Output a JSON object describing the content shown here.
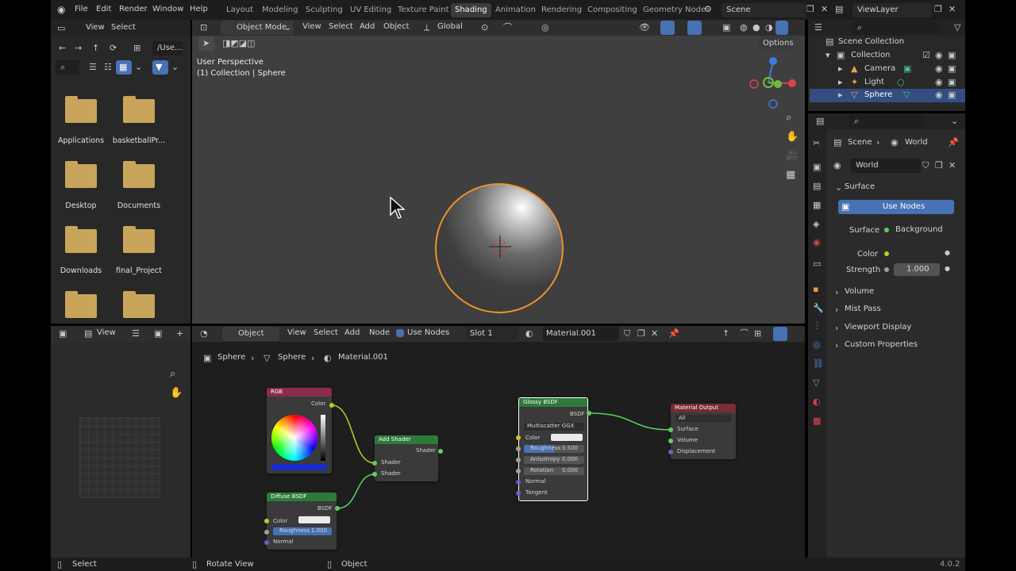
{
  "menu": {
    "file": "File",
    "edit": "Edit",
    "render": "Render",
    "window": "Window",
    "help": "Help"
  },
  "workspaces": [
    "Layout",
    "Modeling",
    "Sculpting",
    "UV Editing",
    "Texture Paint",
    "Shading",
    "Animation",
    "Rendering",
    "Compositing",
    "Geometry Node"
  ],
  "active_workspace": "Shading",
  "scene_field": "Scene",
  "viewlayer_field": "ViewLayer",
  "filebrowser": {
    "view": "View",
    "select": "Select",
    "path": "/Use...",
    "items": [
      "Applications",
      "basketballPr...",
      "Desktop",
      "Documents",
      "Downloads",
      "final_Project"
    ]
  },
  "viewport": {
    "mode": "Object Mode",
    "view": "View",
    "select": "Select",
    "add": "Add",
    "object": "Object",
    "orientation": "Global",
    "options": "Options",
    "overlay_line1": "User Perspective",
    "overlay_line2": "(1) Collection | Sphere"
  },
  "outliner": {
    "scene_collection": "Scene Collection",
    "collection": "Collection",
    "items": [
      "Camera",
      "Light",
      "Sphere"
    ]
  },
  "properties": {
    "breadcrumb_scene": "Scene",
    "breadcrumb_world": "World",
    "world_name": "World",
    "surface_header": "Surface",
    "use_nodes_btn": "Use Nodes",
    "surface_label": "Surface",
    "surface_value": "Background",
    "color_label": "Color",
    "strength_label": "Strength",
    "strength_value": "1.000",
    "sections": [
      "Volume",
      "Mist Pass",
      "Viewport Display",
      "Custom Properties"
    ]
  },
  "image_editor": {
    "view": "View"
  },
  "node_editor": {
    "object": "Object",
    "view": "View",
    "select": "Select",
    "add": "Add",
    "node": "Node",
    "use_nodes": "Use Nodes",
    "slot": "Slot 1",
    "material": "Material.001",
    "breadcrumb": [
      "Sphere",
      "Sphere",
      "Material.001"
    ]
  },
  "nodes": {
    "rgb": {
      "title": "RGB",
      "out": "Color"
    },
    "add_shader": {
      "title": "Add Shader",
      "out": "Shader",
      "in1": "Shader",
      "in2": "Shader"
    },
    "diffuse": {
      "title": "Diffuse BSDF",
      "out": "BSDF",
      "color": "Color",
      "roughness": "Roughness",
      "roughness_val": "1.000",
      "normal": "Normal"
    },
    "glossy": {
      "title": "Glossy BSDF",
      "out": "BSDF",
      "dist": "Multiscatter GGX",
      "color": "Color",
      "roughness": "Roughness",
      "roughness_val": "0.500",
      "anisotropy": "Anisotropy",
      "anisotropy_val": "0.000",
      "rotation": "Rotation",
      "rotation_val": "0.000",
      "normal": "Normal",
      "tangent": "Tangent"
    },
    "output": {
      "title": "Material Output",
      "target": "All",
      "surface": "Surface",
      "volume": "Volume",
      "displacement": "Displacement"
    }
  },
  "statusbar": {
    "select": "Select",
    "rotate": "Rotate View",
    "object": "Object",
    "version": "4.0.2"
  },
  "colors": {
    "accent": "#4772b3",
    "selection": "#f0922c",
    "shader_header": "#2d7a3a",
    "input_header": "#8a2c47",
    "output_header": "#7a2b33"
  }
}
